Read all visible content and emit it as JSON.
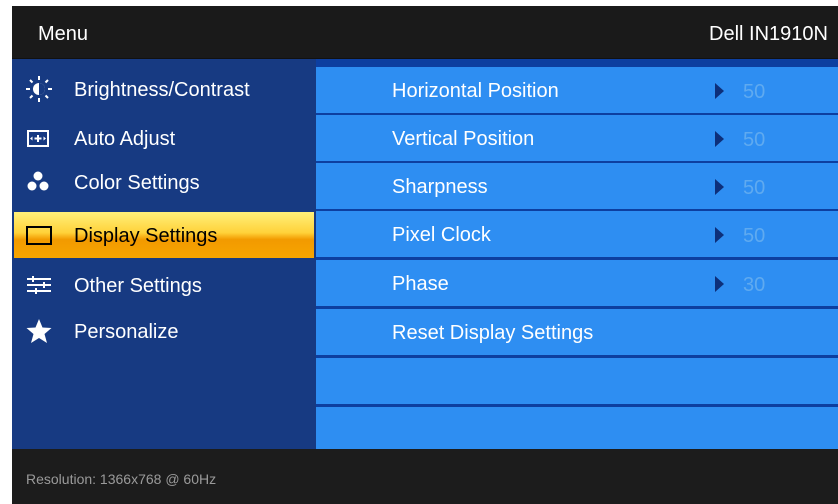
{
  "header": {
    "menu_title": "Menu",
    "model": "Dell IN1910N"
  },
  "sidebar": {
    "items": [
      {
        "label": "Brightness/Contrast",
        "icon": "brightness-icon"
      },
      {
        "label": "Auto Adjust",
        "icon": "auto-adjust-icon"
      },
      {
        "label": "Color Settings",
        "icon": "color-settings-icon"
      },
      {
        "label": "Display Settings",
        "icon": "display-icon",
        "selected": true
      },
      {
        "label": "Other Settings",
        "icon": "sliders-icon"
      },
      {
        "label": "Personalize",
        "icon": "star-icon"
      }
    ]
  },
  "settings": {
    "rows": [
      {
        "label": "Horizontal Position",
        "value": "50"
      },
      {
        "label": "Vertical Position",
        "value": "50"
      },
      {
        "label": "Sharpness",
        "value": "50"
      },
      {
        "label": "Pixel Clock",
        "value": "50"
      },
      {
        "label": "Phase",
        "value": "30"
      },
      {
        "label": "Reset Display Settings"
      }
    ]
  },
  "footer": {
    "resolution": "Resolution: 1366x768 @ 60Hz"
  },
  "colors": {
    "sidebar_bg": "#173a82",
    "row_bg": "#2e8ef2",
    "selected_accent": "#ffd23a",
    "value_text": "#5faaf0"
  }
}
